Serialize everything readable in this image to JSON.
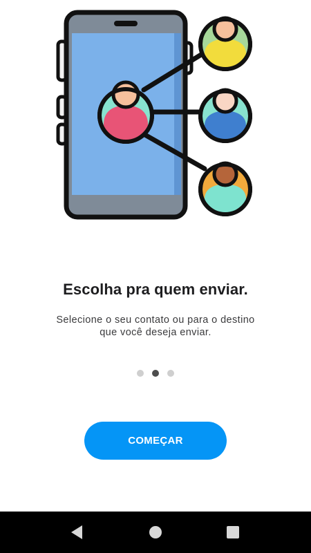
{
  "onboarding": {
    "title": "Escolha pra quem enviar.",
    "subtitle": "Selecione o seu contato ou para o destino que você deseja enviar.",
    "page_indicator": {
      "total": 3,
      "active_index": 1
    },
    "cta_label": "COMEÇAR",
    "illustration_icon": "phone-share-contacts-icon"
  },
  "colors": {
    "accent": "#0595f6",
    "title": "#1d1d1f",
    "subtitle": "#3a3a3c",
    "dot_inactive": "#cfcfcf",
    "dot_active": "#4d4d4d",
    "navbar": "#000000"
  },
  "navbar": {
    "back_icon": "back-triangle-icon",
    "home_icon": "home-circle-icon",
    "recents_icon": "recents-square-icon"
  }
}
